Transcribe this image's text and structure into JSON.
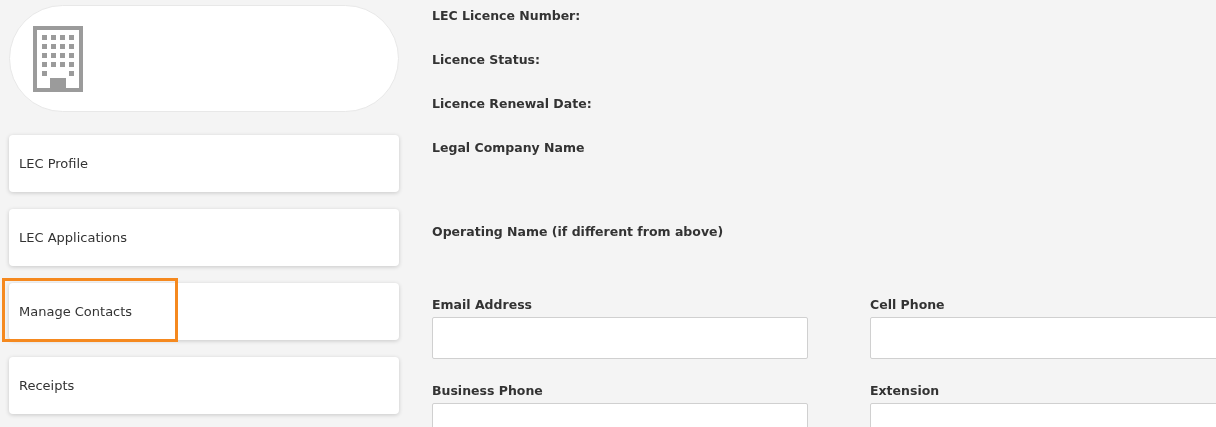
{
  "nav": [
    {
      "label": "LEC Profile",
      "highlighted": false
    },
    {
      "label": "LEC Applications",
      "highlighted": false
    },
    {
      "label": "Manage Contacts",
      "highlighted": true
    },
    {
      "label": "Receipts",
      "highlighted": false
    }
  ],
  "info": [
    {
      "label": "LEC Licence Number:",
      "kind": "line"
    },
    {
      "label": "Licence Status:",
      "kind": "line"
    },
    {
      "label": "Licence Renewal Date:",
      "kind": "line"
    },
    {
      "label": "Legal Company Name",
      "kind": "block"
    },
    {
      "label": "Operating Name (if different from above)",
      "kind": "block"
    }
  ],
  "fields": [
    {
      "label": "Email Address"
    },
    {
      "label": "Cell Phone"
    },
    {
      "label": "Business Phone"
    },
    {
      "label": "Extension"
    }
  ]
}
